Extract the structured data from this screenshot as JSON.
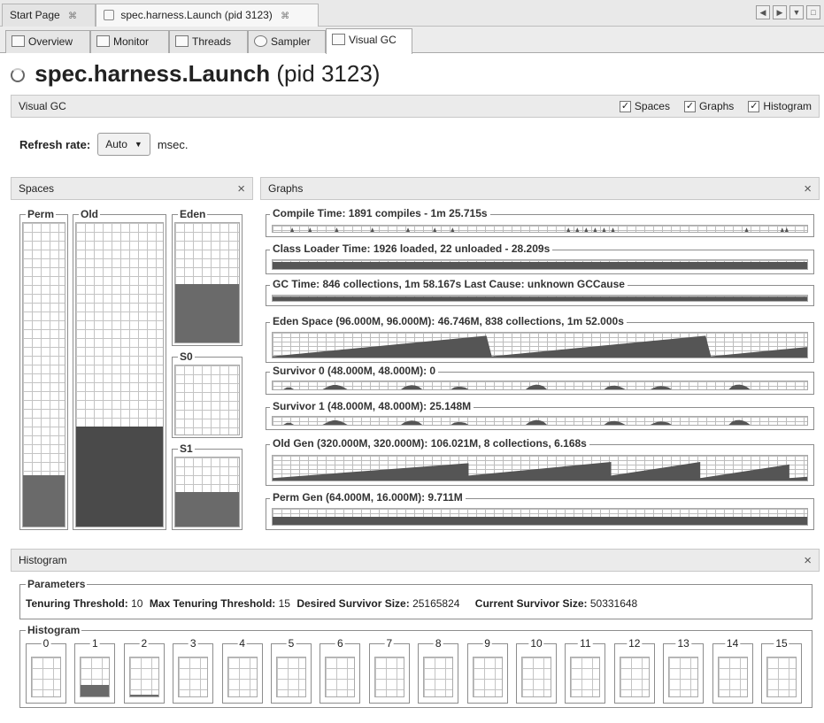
{
  "doc_tabs": [
    {
      "label": "Start Page",
      "close": "⌘",
      "active": false
    },
    {
      "label": "spec.harness.Launch (pid 3123)",
      "close": "⌘",
      "active": true
    }
  ],
  "view_tabs": [
    {
      "label": "Overview",
      "icon": "overview-icon"
    },
    {
      "label": "Monitor",
      "icon": "monitor-icon"
    },
    {
      "label": "Threads",
      "icon": "threads-icon"
    },
    {
      "label": "Sampler",
      "icon": "sampler-icon"
    },
    {
      "label": "Visual GC",
      "icon": "visual-gc-icon",
      "active": true
    }
  ],
  "title": {
    "app": "spec.harness.Launch",
    "pid": "(pid 3123)"
  },
  "visual_gc_bar": {
    "label": "Visual GC",
    "checkboxes": [
      {
        "label": "Spaces",
        "checked": true
      },
      {
        "label": "Graphs",
        "checked": true
      },
      {
        "label": "Histogram",
        "checked": true
      }
    ]
  },
  "refresh": {
    "label": "Refresh rate:",
    "value": "Auto",
    "unit": "msec."
  },
  "spaces": {
    "title": "Spaces",
    "close": "×",
    "perm": {
      "label": "Perm",
      "fill": 0.17
    },
    "old": {
      "label": "Old",
      "fill": 0.33
    },
    "eden": {
      "label": "Eden",
      "fill": 0.49
    },
    "s0": {
      "label": "S0",
      "fill": 0.0
    },
    "s1": {
      "label": "S1",
      "fill": 0.5
    }
  },
  "graphs": {
    "title": "Graphs",
    "close": "×",
    "items": [
      {
        "label": "Compile Time: 1891 compiles - 1m 25.715s"
      },
      {
        "label": "Class Loader Time: 1926 loaded, 22 unloaded - 28.209s"
      },
      {
        "label": "GC Time: 846 collections, 1m 58.167s  Last Cause: unknown GCCause"
      },
      {
        "label": "Eden Space (96.000M, 96.000M): 46.746M, 838 collections, 1m 52.000s"
      },
      {
        "label": "Survivor 0 (48.000M, 48.000M): 0"
      },
      {
        "label": "Survivor 1 (48.000M, 48.000M): 25.148M"
      },
      {
        "label": "Old Gen (320.000M, 320.000M): 106.021M, 8 collections, 6.168s"
      },
      {
        "label": "Perm Gen (64.000M, 16.000M): 9.711M"
      }
    ]
  },
  "histogram": {
    "title": "Histogram",
    "close": "×",
    "parameters_label": "Parameters",
    "params": [
      {
        "key": "Tenuring Threshold:",
        "value": "10"
      },
      {
        "key": "Max Tenuring Threshold:",
        "value": "15"
      },
      {
        "key": "Desired Survivor Size:",
        "value": "25165824"
      },
      {
        "key": "Current Survivor Size:",
        "value": "50331648"
      }
    ],
    "histogram_label": "Histogram",
    "bins": [
      {
        "label": "0",
        "fill": 0
      },
      {
        "label": "1",
        "fill": 0.3
      },
      {
        "label": "2",
        "fill": 0.04
      },
      {
        "label": "3",
        "fill": 0
      },
      {
        "label": "4",
        "fill": 0
      },
      {
        "label": "5",
        "fill": 0
      },
      {
        "label": "6",
        "fill": 0
      },
      {
        "label": "7",
        "fill": 0
      },
      {
        "label": "8",
        "fill": 0
      },
      {
        "label": "9",
        "fill": 0
      },
      {
        "label": "10",
        "fill": 0
      },
      {
        "label": "11",
        "fill": 0
      },
      {
        "label": "12",
        "fill": 0
      },
      {
        "label": "13",
        "fill": 0
      },
      {
        "label": "14",
        "fill": 0
      },
      {
        "label": "15",
        "fill": 0
      }
    ]
  },
  "colors": {
    "fill": "#6a6a6a",
    "old_fill": "#4a4a4a",
    "graph": "#555555"
  }
}
